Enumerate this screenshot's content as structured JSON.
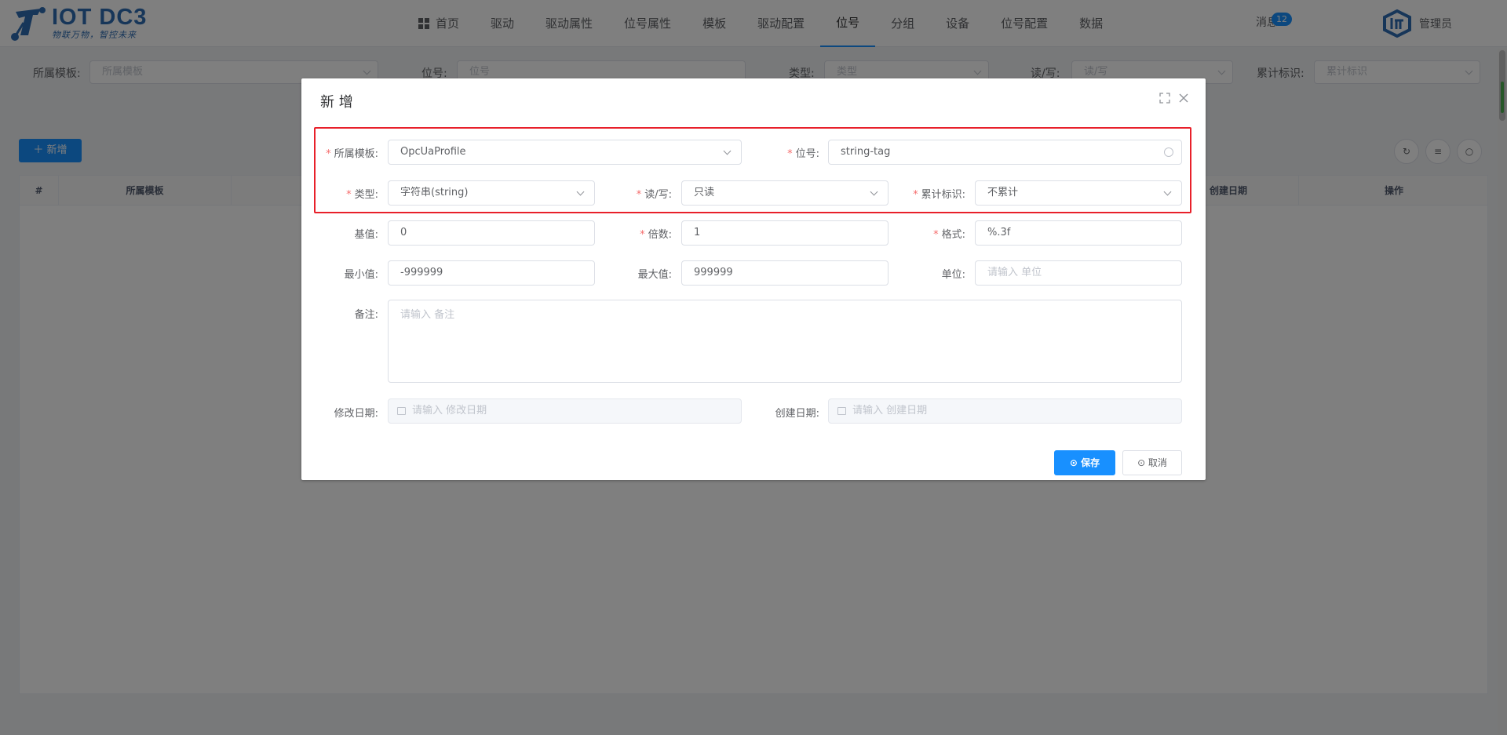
{
  "header": {
    "logo_title": "IOT DC3",
    "logo_sub": "物联万物，智控未来",
    "nav": [
      {
        "label": "首页",
        "active": false
      },
      {
        "label": "驱动",
        "active": false
      },
      {
        "label": "驱动属性",
        "active": false
      },
      {
        "label": "位号属性",
        "active": false
      },
      {
        "label": "模板",
        "active": false
      },
      {
        "label": "驱动配置",
        "active": false
      },
      {
        "label": "位号",
        "active": true
      },
      {
        "label": "分组",
        "active": false
      },
      {
        "label": "设备",
        "active": false
      },
      {
        "label": "位号配置",
        "active": false
      },
      {
        "label": "数据",
        "active": false
      }
    ],
    "messages_label": "消息",
    "messages_count": "12",
    "user_name": "管理员"
  },
  "search": {
    "profile_label": "所属模板:",
    "profile_placeholder": "所属模板",
    "point_label": "位号:",
    "point_placeholder": "位号",
    "type_label": "类型:",
    "type_placeholder": "类型",
    "rw_label": "读/写:",
    "rw_placeholder": "读/写",
    "accrue_label": "累计标识:",
    "accrue_placeholder": "累计标识"
  },
  "toolbar": {
    "add_label": "＋ 新增"
  },
  "table": {
    "columns": [
      "#",
      "所属模板",
      "创建日期",
      "操作"
    ]
  },
  "dialog": {
    "title": "新 增",
    "profile": {
      "label": "所属模板:",
      "value": "OpcUaProfile"
    },
    "point": {
      "label": "位号:",
      "value": "string-tag"
    },
    "type": {
      "label": "类型:",
      "value": "字符串(string)"
    },
    "rw": {
      "label": "读/写:",
      "value": "只读"
    },
    "accrue": {
      "label": "累计标识:",
      "value": "不累计"
    },
    "base": {
      "label": "基值:",
      "value": "0"
    },
    "multiple": {
      "label": "倍数:",
      "value": "1"
    },
    "format": {
      "label": "格式:",
      "value": "%.3f"
    },
    "minimum": {
      "label": "最小值:",
      "value": "-999999"
    },
    "maximum": {
      "label": "最大值:",
      "value": "999999"
    },
    "unit": {
      "label": "单位:",
      "placeholder": "请输入 单位"
    },
    "description": {
      "label": "备注:",
      "placeholder": "请输入 备注"
    },
    "update_time": {
      "label": "修改日期:",
      "placeholder": "请输入 修改日期"
    },
    "create_time": {
      "label": "创建日期:",
      "placeholder": "请输入 创建日期"
    },
    "save_label": "⊙ 保存",
    "cancel_label": "⊙ 取消"
  },
  "colors": {
    "primary": "#1890ff",
    "highlight_border": "#e8202a",
    "required": "#f56c6c"
  }
}
